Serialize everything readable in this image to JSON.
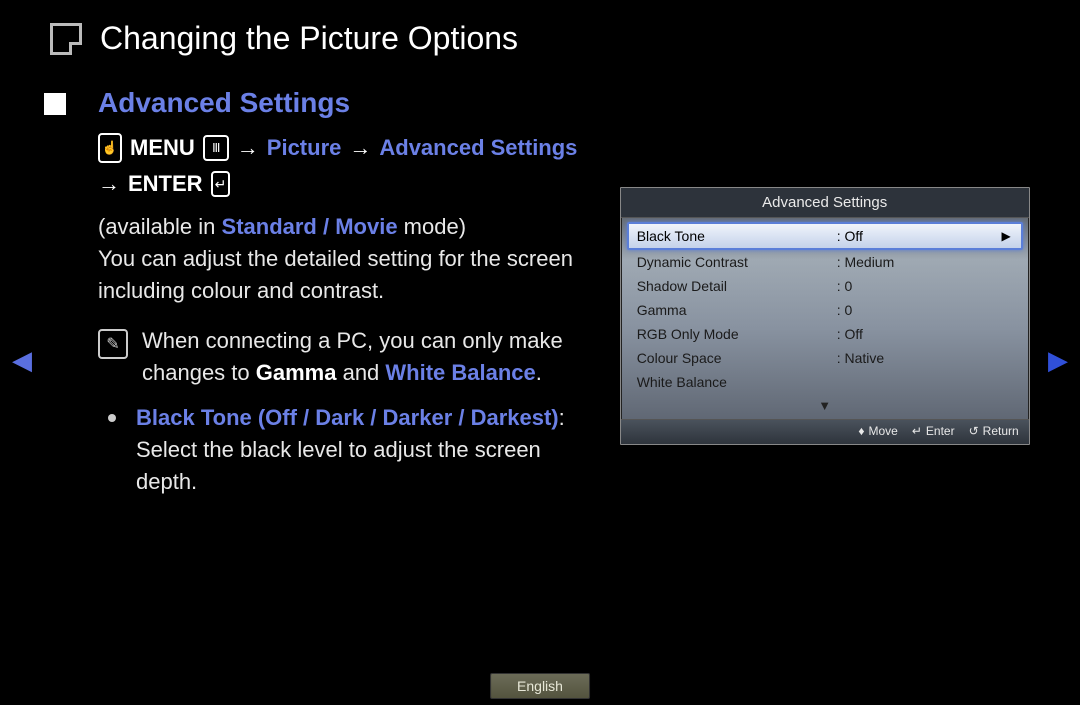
{
  "title": "Changing the Picture Options",
  "section_heading": "Advanced Settings",
  "breadcrumb": {
    "menu": "MENU",
    "step1": "Picture",
    "step2": "Advanced Settings",
    "enter": "ENTER",
    "arrow": "→"
  },
  "available_prefix": "(available in ",
  "available_modes": "Standard / Movie",
  "available_suffix": " mode)",
  "desc": "You can adjust the detailed setting for the screen including colour and contrast.",
  "note_part1": "When connecting a PC, you can only make changes to ",
  "note_gamma": "Gamma",
  "note_and": " and ",
  "note_wb": "White Balance",
  "note_period": ".",
  "bullet_title": "Black Tone (Off / Dark / Darker / Darkest)",
  "bullet_colon": ": ",
  "bullet_body": "Select the black level to adjust the screen depth.",
  "osd": {
    "title": "Advanced Settings",
    "rows": [
      {
        "label": "Black Tone",
        "value": ": Off",
        "selected": true
      },
      {
        "label": "Dynamic Contrast",
        "value": ": Medium",
        "selected": false
      },
      {
        "label": "Shadow Detail",
        "value": ": 0",
        "selected": false
      },
      {
        "label": "Gamma",
        "value": ": 0",
        "selected": false
      },
      {
        "label": "RGB Only Mode",
        "value": ": Off",
        "selected": false
      },
      {
        "label": "Colour Space",
        "value": ": Native",
        "selected": false
      },
      {
        "label": "White Balance",
        "value": "",
        "selected": false
      }
    ],
    "more": "▼",
    "footer": {
      "move": "Move",
      "enter": "Enter",
      "return": "Return"
    }
  },
  "language": "English",
  "nav": {
    "prev": "◀",
    "next": "▶"
  }
}
